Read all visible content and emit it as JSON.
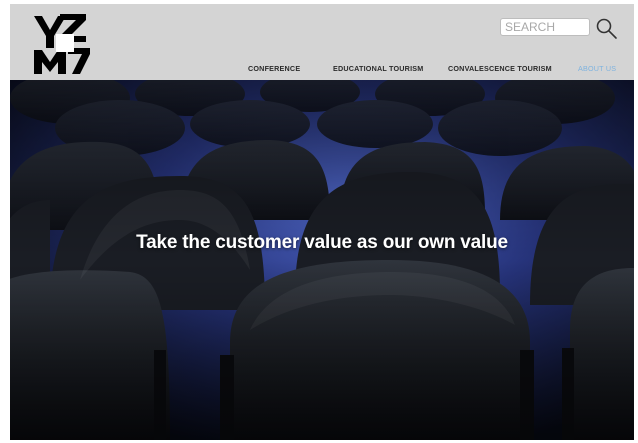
{
  "header": {
    "logo_text": "YZMZ",
    "search": {
      "placeholder": "SEARCH",
      "value": ""
    },
    "nav": [
      {
        "label": "CONFERENCE"
      },
      {
        "label": "EDUCATIONAL TOURISM"
      },
      {
        "label": "CONVALESCENCE TOURISM"
      },
      {
        "label": "ABOUT US",
        "active": true
      }
    ]
  },
  "hero": {
    "tagline": "Take the customer value as our own value"
  },
  "colors": {
    "header_bg": "#d4d4d4",
    "active_nav": "#7fb3df",
    "nav_text": "#2b2b2b",
    "seat_blue": "#3a4fa8"
  },
  "icons": {
    "search_button": "magnifier-icon"
  }
}
